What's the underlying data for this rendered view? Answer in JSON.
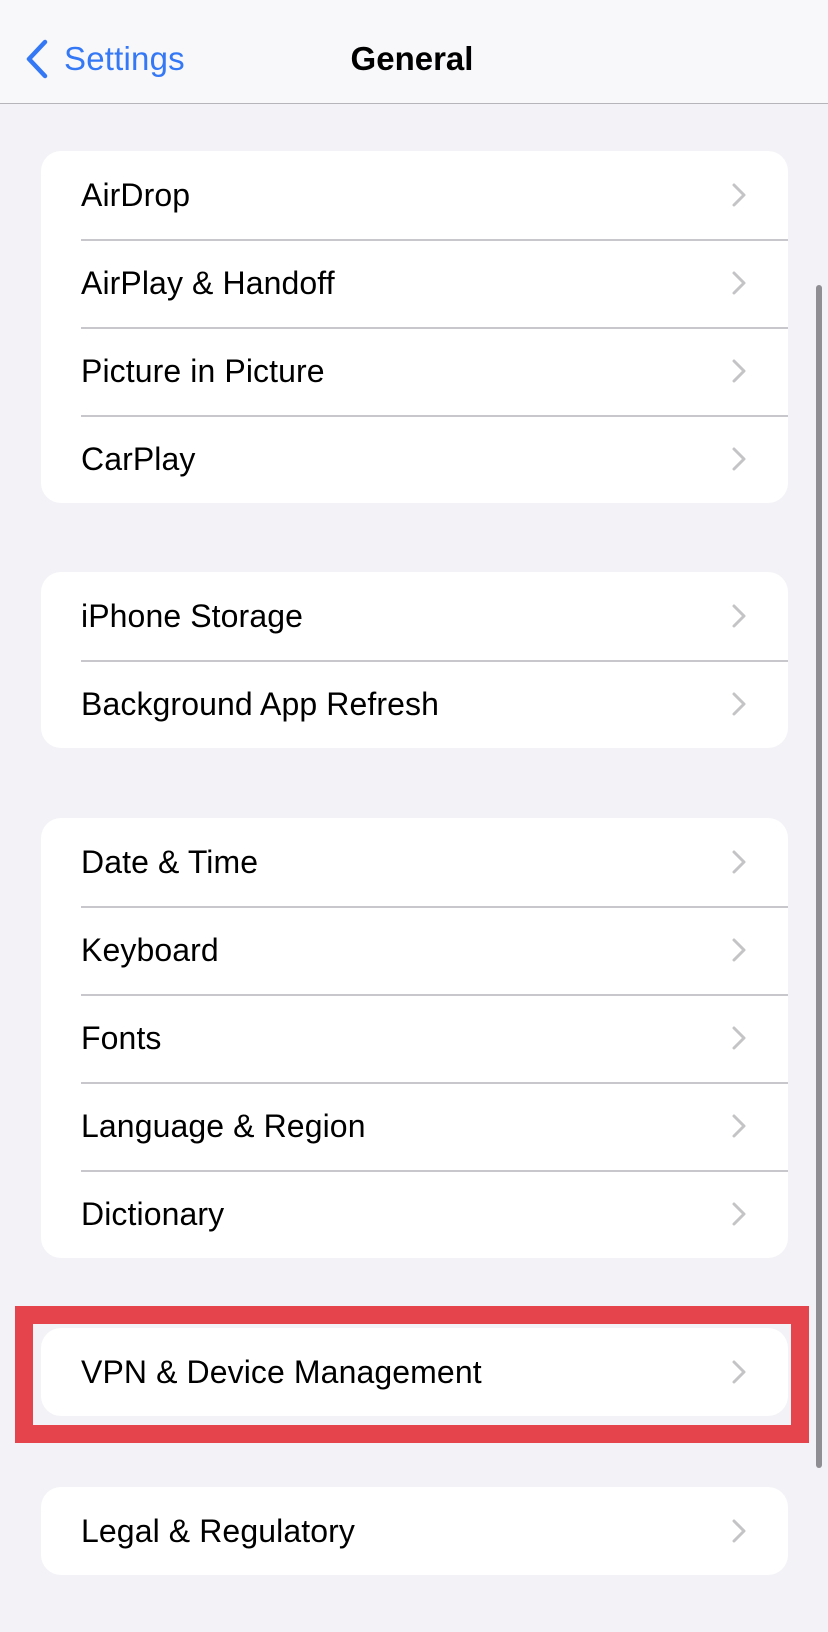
{
  "navbar": {
    "back_label": "Settings",
    "title": "General",
    "back_icon": "chevron-left-icon",
    "accent_color": "#3478f6"
  },
  "groups": [
    {
      "items": [
        {
          "label": "AirDrop"
        },
        {
          "label": "AirPlay & Handoff"
        },
        {
          "label": "Picture in Picture"
        },
        {
          "label": "CarPlay"
        }
      ]
    },
    {
      "items": [
        {
          "label": "iPhone Storage"
        },
        {
          "label": "Background App Refresh"
        }
      ]
    },
    {
      "items": [
        {
          "label": "Date & Time"
        },
        {
          "label": "Keyboard"
        },
        {
          "label": "Fonts"
        },
        {
          "label": "Language & Region"
        },
        {
          "label": "Dictionary"
        }
      ]
    },
    {
      "items": [
        {
          "label": "VPN & Device Management",
          "highlighted": true
        }
      ]
    },
    {
      "items": [
        {
          "label": "Legal & Regulatory"
        }
      ]
    }
  ],
  "highlight": {
    "target": "VPN & Device Management",
    "color": "#e5444d"
  },
  "row_icon": "chevron-right-icon"
}
